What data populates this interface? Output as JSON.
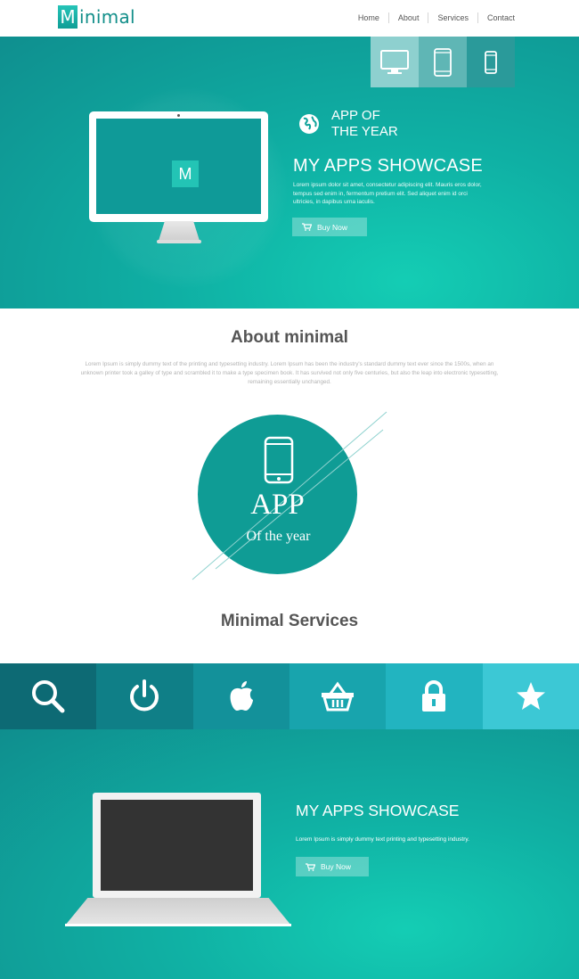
{
  "header": {
    "logo_letter": "M",
    "logo_text": "inimal",
    "nav": [
      "Home",
      "About",
      "Services",
      "Contact"
    ]
  },
  "hero": {
    "device_tabs": [
      "desktop-icon",
      "tablet-icon",
      "phone-icon"
    ],
    "monitor_logo": "M",
    "badge_line1": "APP OF",
    "badge_line2": "THE YEAR",
    "title": "MY APPS SHOWCASE",
    "text": "Lorem ipsum dolor sit amet, consectetur adipiscing elit. Mauris eros dolor, tempus sed enim in, fermentum pretium elit. Sed aliquet enim id orci ultricies, in dapibus urna iaculis.",
    "button_label": "Buy Now"
  },
  "about": {
    "title": "About minimal",
    "text": "Lorem Ipsum is simply dummy text of the printing and typesetting industry. Lorem Ipsum has been the industry's standard dummy text ever since the 1500s, when an unknown printer took a galley of type and scrambled it to make a type specimen book. It has survived not only five centuries, but also the leap into electronic typesetting, remaining essentially unchanged.",
    "circle_title": "APP",
    "circle_subtitle": "Of the year"
  },
  "services": {
    "title": "Minimal Services",
    "icons": [
      "search-icon",
      "power-icon",
      "apple-icon",
      "basket-icon",
      "lock-icon",
      "star-icon"
    ]
  },
  "showcase": {
    "title": "MY APPS SHOWCASE",
    "text": "Lorem Ipsum is simply dummy text printing and typesetting industry.",
    "button_label": "Buy Now"
  },
  "colors": {
    "accent": "#0f9c95",
    "logo": "#138f8a"
  }
}
